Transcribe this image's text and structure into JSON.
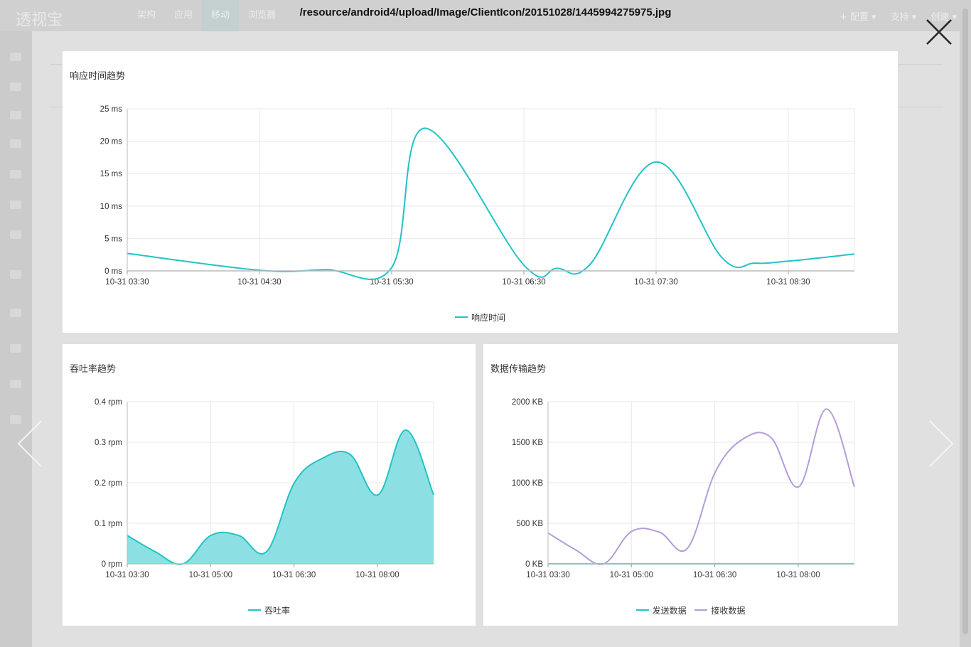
{
  "lightbox": {
    "title": "/resource/android4/upload/Image/ClientIcon/20151028/1445994275975.jpg"
  },
  "background_app": {
    "logo": "透视宝",
    "nav": [
      "架构",
      "应用",
      "移动",
      "浏览器"
    ],
    "right": [
      "+ 配置 ▾",
      "支持 ▾",
      "创建 ▾"
    ]
  },
  "colors": {
    "teal": "#22C3C6",
    "teal_fill": "#8CE0E3",
    "purple": "#B39DDB",
    "grid": "#E8E8E8",
    "axis": "#BBBBBB"
  },
  "chart_data": [
    {
      "type": "line",
      "title": "响应时间趋势",
      "x_ticks": [
        "10-31 03:30",
        "10-31 04:30",
        "10-31 05:30",
        "10-31 06:30",
        "10-31 07:30",
        "10-31 08:30"
      ],
      "y_ticks": [
        "0 ms",
        "5 ms",
        "10 ms",
        "15 ms",
        "20 ms",
        "25 ms"
      ],
      "ylim": [
        0,
        25
      ],
      "xlim_min": [
        210,
        540
      ],
      "series": [
        {
          "name": "响应时间",
          "color": "#22C3C6",
          "x_min": [
            210,
            270,
            300,
            330,
            345,
            390,
            405,
            420,
            450,
            480,
            495,
            510,
            540
          ],
          "values": [
            2.7,
            0.1,
            0.2,
            0.5,
            22.0,
            0.9,
            0.4,
            1.0,
            16.8,
            2.0,
            1.2,
            1.5,
            2.6
          ]
        }
      ]
    },
    {
      "type": "area",
      "title": "吞吐率趋势",
      "x_ticks": [
        "10-31 03:30",
        "10-31 05:00",
        "10-31 06:30",
        "10-31 08:00"
      ],
      "y_ticks": [
        "0 rpm",
        "0.1 rpm",
        "0.2 rpm",
        "0.3 rpm",
        "0.4 rpm"
      ],
      "ylim": [
        0,
        0.4
      ],
      "xlim_min": [
        210,
        540
      ],
      "series": [
        {
          "name": "吞吐率",
          "color": "#22C3C6",
          "fill": "#8CE0E3",
          "x_min": [
            210,
            240,
            270,
            300,
            330,
            360,
            390,
            420,
            450,
            480,
            510,
            540
          ],
          "values": [
            0.07,
            0.03,
            0.0,
            0.07,
            0.07,
            0.03,
            0.2,
            0.26,
            0.27,
            0.17,
            0.33,
            0.17
          ]
        }
      ]
    },
    {
      "type": "line",
      "title": "数据传输趋势",
      "x_ticks": [
        "10-31 03:30",
        "10-31 05:00",
        "10-31 06:30",
        "10-31 08:00"
      ],
      "y_ticks": [
        "0 KB",
        "500 KB",
        "1000 KB",
        "1500 KB",
        "2000 KB"
      ],
      "ylim": [
        0,
        2000
      ],
      "xlim_min": [
        210,
        540
      ],
      "series": [
        {
          "name": "发送数据",
          "color": "#22C3C6",
          "x_min": [
            210,
            540
          ],
          "values": [
            0,
            0
          ]
        },
        {
          "name": "接收数据",
          "color": "#B39DDB",
          "x_min": [
            210,
            240,
            270,
            300,
            330,
            360,
            390,
            420,
            450,
            480,
            510,
            540
          ],
          "values": [
            380,
            170,
            0,
            400,
            390,
            190,
            1130,
            1540,
            1560,
            950,
            1910,
            950
          ]
        }
      ]
    }
  ]
}
